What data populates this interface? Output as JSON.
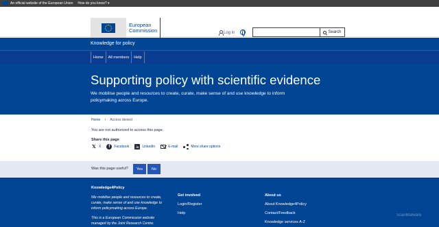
{
  "topbar": {
    "official_text": "An official website of the European Union",
    "how_text": "How do you know?"
  },
  "header": {
    "logo_line1": "European",
    "logo_line2": "Commission",
    "login_label": "Log in",
    "search_placeholder": "",
    "search_button": "Search"
  },
  "site_name": "Knowledge for policy",
  "menu": {
    "items": [
      {
        "label": "Home"
      },
      {
        "label": "All members"
      },
      {
        "label": "Help"
      }
    ]
  },
  "hero": {
    "title": "Supporting policy with scientific evidence",
    "text": "We mobilise people and resources to create, curate, make sense of and use knowledge to inform policymaking across Europe."
  },
  "breadcrumb": {
    "home": "Home",
    "current": "Access denied"
  },
  "content": {
    "message": "You are not authorized to access this page."
  },
  "share": {
    "title": "Share this page",
    "links": [
      {
        "label": "X",
        "icon": "x-icon"
      },
      {
        "label": "Facebook",
        "icon": "facebook-icon"
      },
      {
        "label": "LinkedIn",
        "icon": "linkedin-icon"
      },
      {
        "label": "E-mail",
        "icon": "mail-icon"
      },
      {
        "label": "More share options",
        "icon": "share-icon"
      }
    ]
  },
  "feedback": {
    "question": "Was this page useful?",
    "yes": "Yes",
    "no": "No"
  },
  "footer": {
    "title": "Knowledge4Policy",
    "description": "We mobilise people and resources to create, curate, make sense of and use knowledge to inform policymaking across Europe.",
    "description2": "This is a European Commission website managed by the Joint Research Centre.",
    "col2_title": "Get involved",
    "col2_links": [
      "Login/Register",
      "Help"
    ],
    "col3_title": "About us",
    "col3_links": [
      "About Knowledge4Policy",
      "Contact/Feedback",
      "Knowledge services A-Z"
    ]
  },
  "watermark": "ScanMalware",
  "colors": {
    "primary": "#004494",
    "menu": "#0a3d91",
    "button": "#2457b4",
    "feedback_bg": "#e3e8f3",
    "topbar": "#404040"
  }
}
